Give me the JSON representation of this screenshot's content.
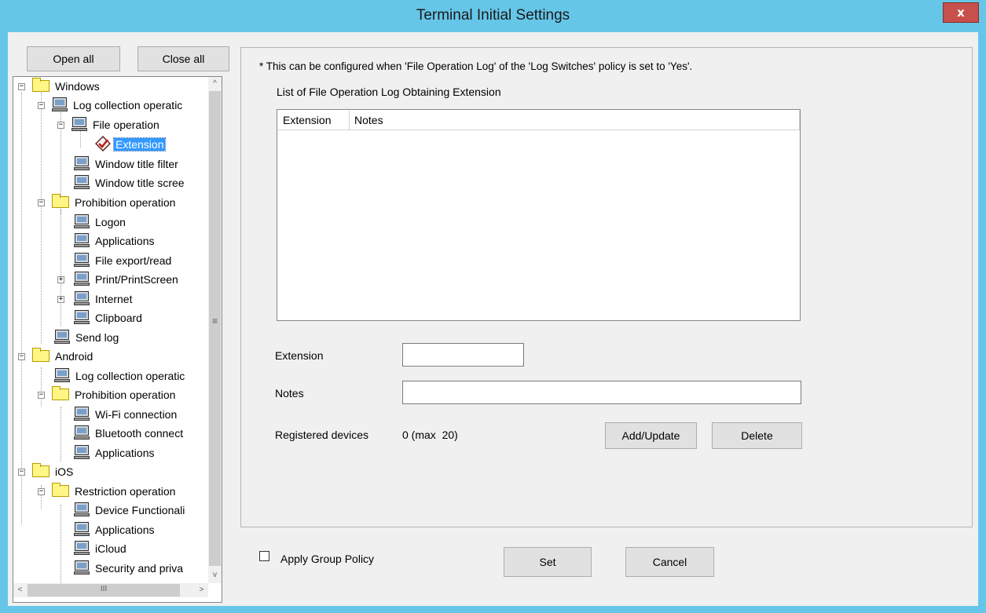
{
  "window": {
    "title": "Terminal Initial Settings",
    "close_glyph": "x"
  },
  "toolbar": {
    "open_all": "Open all",
    "close_all": "Close all"
  },
  "tree": {
    "windows": {
      "label": "Windows",
      "log_collection": "Log collection operatic",
      "file_operation": "File operation",
      "extension": "Extension",
      "window_title_filter": "Window title filter",
      "window_title_screen": "Window title scree",
      "prohibition": "Prohibition operation",
      "logon": "Logon",
      "applications": "Applications",
      "file_export": "File export/read",
      "print": "Print/PrintScreen",
      "internet": "Internet",
      "clipboard": "Clipboard",
      "send_log": "Send log"
    },
    "android": {
      "label": "Android",
      "log_collection": "Log collection operatic",
      "prohibition": "Prohibition operation",
      "wifi": "Wi-Fi connection",
      "bluetooth": "Bluetooth connect",
      "applications": "Applications"
    },
    "ios": {
      "label": "iOS",
      "restriction": "Restriction operation",
      "device_functionality": "Device Functionali",
      "applications": "Applications",
      "icloud": "iCloud",
      "security": "Security and priva"
    },
    "scroll": {
      "up": "^",
      "down": "v",
      "left": "<",
      "right": ">",
      "grip_v": "≡",
      "grip_h": "III"
    }
  },
  "panel": {
    "note": "* This can be configured when 'File Operation Log' of the 'Log Switches' policy is set to 'Yes'.",
    "list_title": "List of File Operation Log Obtaining Extension",
    "columns": [
      "Extension",
      "Notes"
    ],
    "extension_label": "Extension",
    "extension_value": "",
    "notes_label": "Notes",
    "notes_value": "",
    "registered_label": "Registered devices",
    "registered_value": "0 (max  20)",
    "add_update": "Add/Update",
    "delete": "Delete"
  },
  "footer": {
    "apply_group_policy": "Apply Group Policy",
    "set": "Set",
    "cancel": "Cancel"
  }
}
